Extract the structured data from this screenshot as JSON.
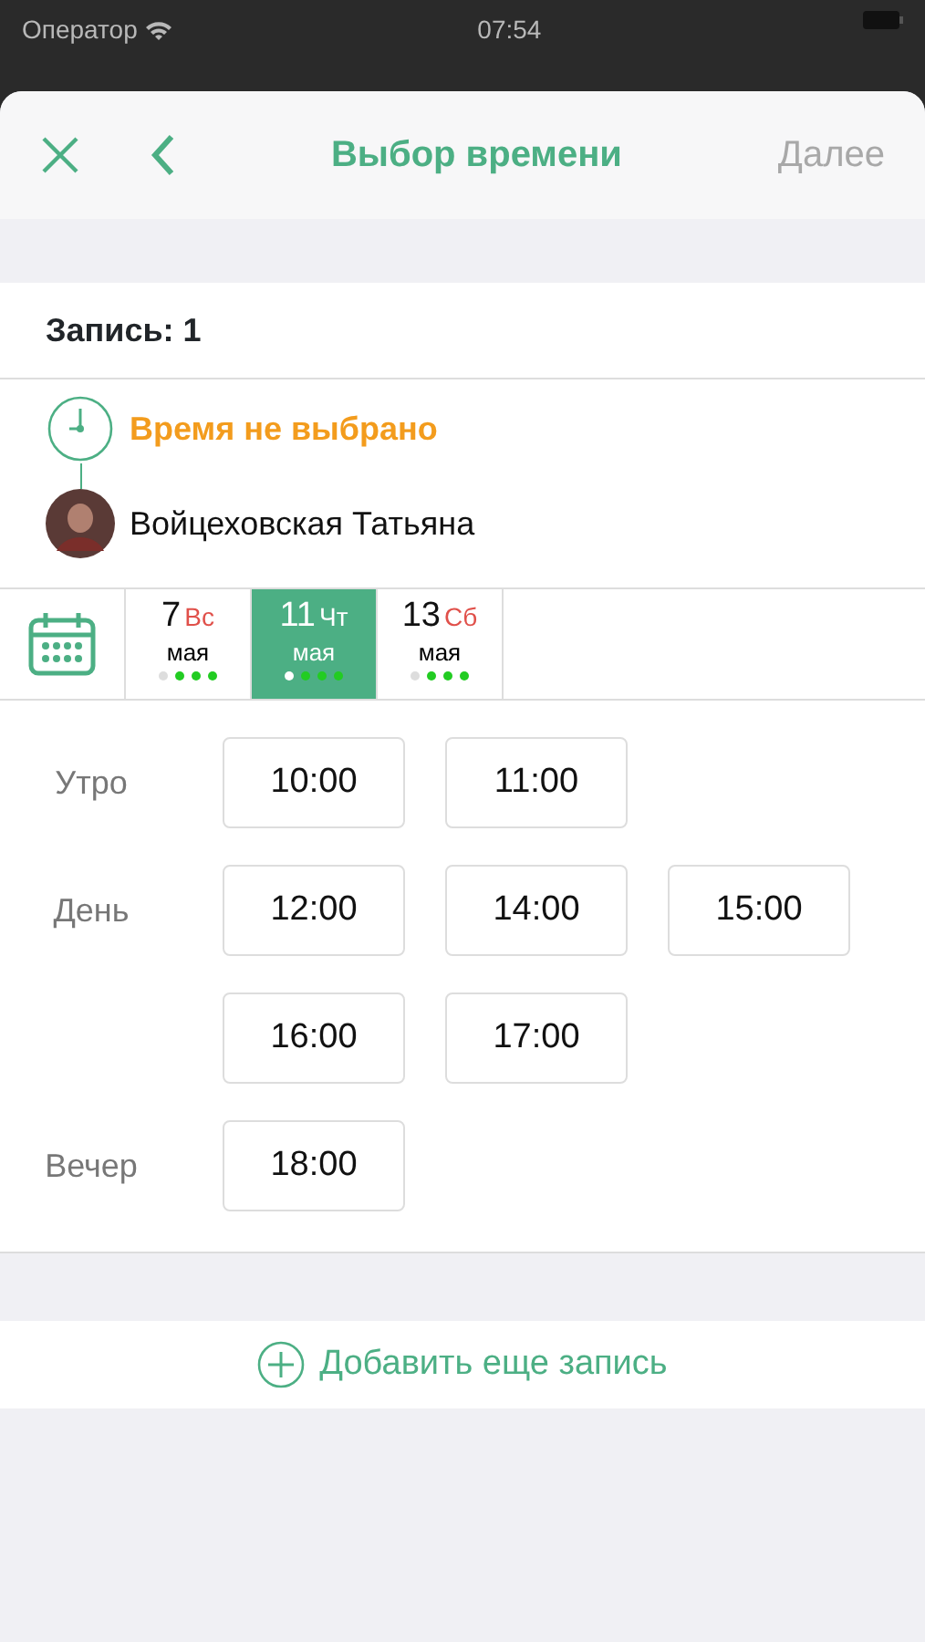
{
  "status_bar": {
    "carrier": "Оператор",
    "time": "07:54"
  },
  "header": {
    "title": "Выбор времени",
    "next": {
      "label": "Далее",
      "disabled": true
    }
  },
  "record": {
    "title": "Запись: 1"
  },
  "summary": {
    "time_status": "Время не выбрано",
    "master": "Войцеховская Татьяна"
  },
  "days": [
    {
      "day": "7",
      "weekday": "Вс",
      "month": "мая",
      "weekend": true,
      "selected": false,
      "dots": [
        {
          "color": "#dddddd"
        },
        {
          "color": "#22cc22"
        },
        {
          "color": "#22cc22"
        },
        {
          "color": "#22cc22"
        }
      ]
    },
    {
      "day": "11",
      "weekday": "Чт",
      "month": "мая",
      "weekend": false,
      "selected": true,
      "dots": [
        {
          "color": "#ffffff"
        },
        {
          "color": "#22cc22"
        },
        {
          "color": "#22cc22"
        },
        {
          "color": "#22cc22"
        }
      ]
    },
    {
      "day": "13",
      "weekday": "Сб",
      "month": "мая",
      "weekend": true,
      "selected": false,
      "dots": [
        {
          "color": "#dddddd"
        },
        {
          "color": "#22cc22"
        },
        {
          "color": "#22cc22"
        },
        {
          "color": "#22cc22"
        }
      ]
    }
  ],
  "time_groups": [
    {
      "label": "Утро",
      "slots": [
        "10:00",
        "11:00"
      ]
    },
    {
      "label": "День",
      "slots": [
        "12:00",
        "14:00",
        "15:00",
        "16:00",
        "17:00"
      ]
    },
    {
      "label": "Вечер",
      "slots": [
        "18:00"
      ]
    }
  ],
  "add_button": {
    "label": "Добавить еще запись"
  }
}
